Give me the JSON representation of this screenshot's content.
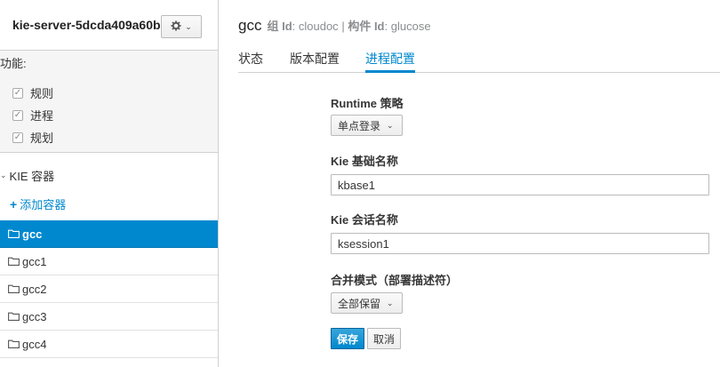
{
  "sidebar": {
    "server_name": "kie-server-5dcda409a60b",
    "features_title": "功能:",
    "capabilities": [
      {
        "label": "规则",
        "checked": true
      },
      {
        "label": "进程",
        "checked": true
      },
      {
        "label": "规划",
        "checked": true
      }
    ],
    "kie_containers_title": "KIE 容器",
    "add_container_label": "添加容器",
    "containers": [
      {
        "name": "gcc",
        "active": true
      },
      {
        "name": "gcc1",
        "active": false
      },
      {
        "name": "gcc2",
        "active": false
      },
      {
        "name": "gcc3",
        "active": false
      },
      {
        "name": "gcc4",
        "active": false
      }
    ]
  },
  "header": {
    "container_name": "gcc",
    "group_id_label": "组 Id",
    "group_id_value": "cloudoc",
    "separator": "|",
    "artifact_id_label": "构件 Id",
    "artifact_id_value": "glucose"
  },
  "tabs": [
    {
      "label": "状态",
      "active": false
    },
    {
      "label": "版本配置",
      "active": false
    },
    {
      "label": "进程配置",
      "active": true
    }
  ],
  "form": {
    "runtime_strategy_label": "Runtime 策略",
    "runtime_strategy_value": "单点登录",
    "kbase_label": "Kie 基础名称",
    "kbase_value": "kbase1",
    "ksession_label": "Kie 会话名称",
    "ksession_value": "ksession1",
    "merge_mode_label": "合并模式（部署描述符）",
    "merge_mode_value": "全部保留",
    "save_label": "保存",
    "cancel_label": "取消"
  },
  "colors": {
    "accent": "#0088ce",
    "muted": "#8b8d8f"
  }
}
